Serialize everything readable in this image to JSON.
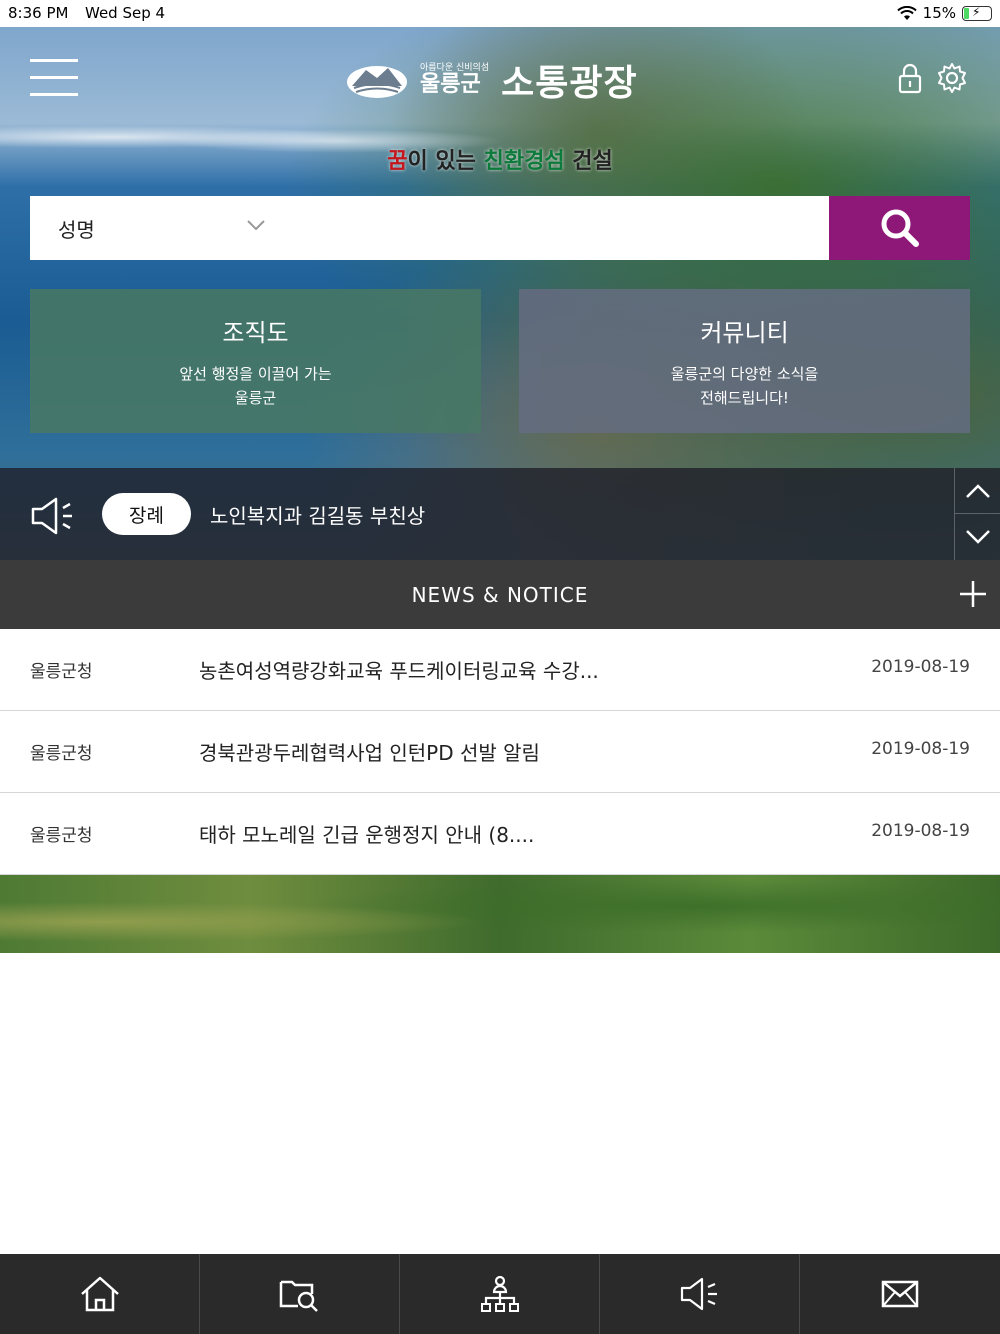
{
  "status_bar": {
    "time": "8:36 PM",
    "date": "Wed Sep 4",
    "battery": "15%"
  },
  "header": {
    "logo_small": "아름다운 신비의섬",
    "logo_county": "울릉군",
    "title": "소통광장"
  },
  "slogan": {
    "part1": "꿈",
    "part2": "이 있는 ",
    "part3": "친환경섬",
    "part4": " 건설"
  },
  "search": {
    "field_selected": "성명",
    "placeholder": ""
  },
  "tiles": [
    {
      "title": "조직도",
      "desc_line1": "앞선 행정을 이끌어 가는",
      "desc_line2": "울릉군"
    },
    {
      "title": "커뮤니티",
      "desc_line1": "울릉군의 다양한 소식을",
      "desc_line2": "전해드립니다!"
    }
  ],
  "notice": {
    "badge": "장례",
    "text": "노인복지과 김길동 부친상"
  },
  "news": {
    "header": "NEWS & NOTICE",
    "items": [
      {
        "source": "울릉군청",
        "title": "농촌여성역량강화교육 푸드케이터링교육 수강...",
        "date": "2019-08-19"
      },
      {
        "source": "울릉군청",
        "title": "경북관광두레협력사업 인턴PD 선발 알림",
        "date": "2019-08-19"
      },
      {
        "source": "울릉군청",
        "title": "태하 모노레일 긴급 운행정지 안내 (8....",
        "date": "2019-08-19"
      }
    ]
  },
  "tabbar": [
    "home-icon",
    "folder-search-icon",
    "org-chart-icon",
    "announcement-icon",
    "mail-icon"
  ],
  "colors": {
    "search_button": "#8e1877",
    "news_header": "#3b3b3b",
    "tabbar": "#2a2a2a",
    "slogan_red": "#c4161c",
    "slogan_green": "#0c7a3a"
  }
}
